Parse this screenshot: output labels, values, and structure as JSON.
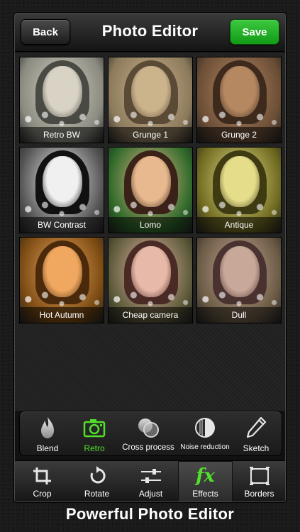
{
  "header": {
    "back_label": "Back",
    "title": "Photo Editor",
    "save_label": "Save",
    "save_color": "#22b525"
  },
  "filters": [
    {
      "label": "Retro BW",
      "tone": [
        "#8a8a80",
        "#d8d3c4",
        "#4a4a44"
      ]
    },
    {
      "label": "Grunge 1",
      "tone": [
        "#8c7a5c",
        "#cbb38c",
        "#5a4a36"
      ]
    },
    {
      "label": "Grunge 2",
      "tone": [
        "#6b4e36",
        "#b58862",
        "#3e2a1c"
      ]
    },
    {
      "label": "BW Contrast",
      "tone": [
        "#555555",
        "#f0f0f0",
        "#111111"
      ]
    },
    {
      "label": "Lomo",
      "tone": [
        "#2f6a2a",
        "#e8b98e",
        "#3b2218"
      ]
    },
    {
      "label": "Antique",
      "tone": [
        "#6f6a20",
        "#e6dd8a",
        "#3e3a12"
      ]
    },
    {
      "label": "Hot Autumn",
      "tone": [
        "#7a4a12",
        "#f0a860",
        "#4a2a0a"
      ]
    },
    {
      "label": "Cheap camera",
      "tone": [
        "#5d5a3a",
        "#e7b9a8",
        "#4a2a24"
      ]
    },
    {
      "label": "Dull",
      "tone": [
        "#6a5a44",
        "#c8a898",
        "#4a3230"
      ]
    }
  ],
  "tools": [
    {
      "label": "Blend",
      "icon": "flame-icon",
      "active": false
    },
    {
      "label": "Retro",
      "icon": "camera-icon",
      "active": true
    },
    {
      "label": "Cross process",
      "icon": "overlap-circles-icon",
      "active": false
    },
    {
      "label": "Noise reduction",
      "icon": "half-circle-icon",
      "active": false
    },
    {
      "label": "Sketch",
      "icon": "pencil-icon",
      "active": false
    }
  ],
  "tabs": [
    {
      "label": "Crop",
      "icon": "crop-icon",
      "selected": false
    },
    {
      "label": "Rotate",
      "icon": "rotate-icon",
      "selected": false
    },
    {
      "label": "Adjust",
      "icon": "sliders-icon",
      "selected": false
    },
    {
      "label": "Effects",
      "icon": "fx-icon",
      "selected": true
    },
    {
      "label": "Borders",
      "icon": "border-frame-icon",
      "selected": false
    }
  ],
  "fx_glyph": "fx",
  "accent_green": "#52e02a",
  "caption": "Powerful Photo Editor"
}
